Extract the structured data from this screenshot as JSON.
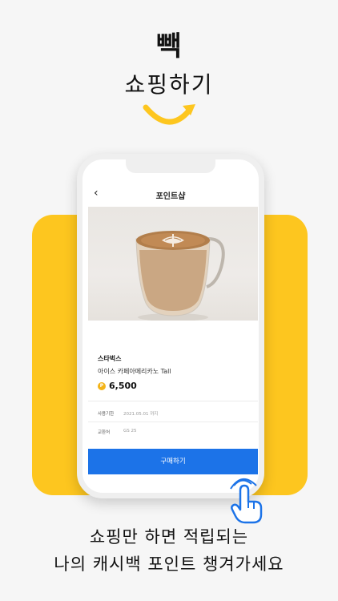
{
  "hero": {
    "title": "빽",
    "subtitle": "쇼핑하기"
  },
  "screen": {
    "nav_title": "포인트샵",
    "back_icon": "‹",
    "brand": "스타벅스",
    "product_name": "아이스 카페아메리카노 Tall",
    "coin_symbol": "P",
    "price": "6,500",
    "expiry_label": "사용기한",
    "expiry_value": "2021.05.01 까지",
    "exchange_label": "교환처",
    "exchange_value": "GS 25",
    "buy_button": "구매하기"
  },
  "caption": {
    "line1": "쇼핑만 하면 적립되는",
    "line2": "나의 캐시백 포인트 챙겨가세요"
  },
  "colors": {
    "accent_yellow": "#fdc61f",
    "button_blue": "#1c73e8",
    "background": "#f6f6f6"
  },
  "icons": [
    "back-chevron-icon",
    "smile-arrow-icon",
    "tap-hand-icon",
    "point-coin-icon"
  ]
}
